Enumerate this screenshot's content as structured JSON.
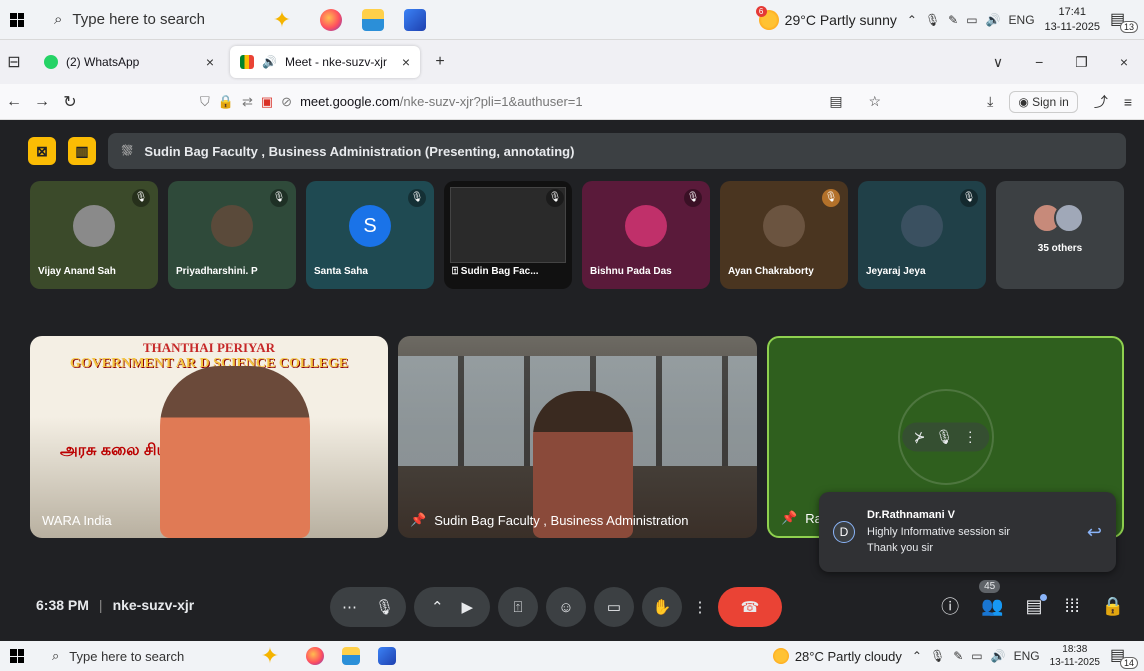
{
  "taskbar_top": {
    "search_placeholder": "Type here to search",
    "weather": "29°C  Partly sunny",
    "weather_badge": "6",
    "lang": "ENG",
    "time": "17:41",
    "date": "13-11-2025",
    "notifications": "13"
  },
  "tabs": [
    {
      "label": "(2) WhatsApp",
      "close": "×"
    },
    {
      "label": "Meet - nke-suzv-xjr",
      "close": "×"
    }
  ],
  "new_tab": "+",
  "window_controls": {
    "dropdown": "∨",
    "minimize": "−",
    "restore": "❐",
    "close": "×"
  },
  "navbar": {
    "url_host": "meet.google.com",
    "url_path": "/nke-suzv-xjr?pli=1&authuser=1",
    "sign_in": "Sign in"
  },
  "presenter_bar": {
    "text": "Sudin Bag Faculty , Business Administration (Presenting, annotating)"
  },
  "participants": [
    {
      "name": "Vijay Anand Sah",
      "bg": "#3b4a2a"
    },
    {
      "name": "Priyadharshini. P",
      "bg": "#2f4a3a"
    },
    {
      "name": "Santa Saha",
      "bg": "#1f4a52",
      "letter": "S"
    },
    {
      "name": "Sudin Bag Fac...",
      "bg": "#111"
    },
    {
      "name": "Bishnu Pada Das",
      "bg": "#5a1a3a"
    },
    {
      "name": "Ayan Chakraborty",
      "bg": "#4a3520"
    },
    {
      "name": "Jeyaraj Jeya",
      "bg": "#204048"
    }
  ],
  "others": {
    "label": "35 others"
  },
  "main_tiles": {
    "tile1": {
      "poster_line1": "THANTHAI PERIYAR",
      "poster_line2": "GOVERNMENT AR    D SCIENCE COLLEGE",
      "tamil": "அரசு கலை      சியல் கல்லூரி",
      "label": "WARA India"
    },
    "tile2": {
      "label": "Sudin Bag Faculty , Business Administration"
    },
    "tile3": {
      "label": "Ra"
    }
  },
  "chat_toast": {
    "initial": "D",
    "sender": "Dr.Rathnamani V",
    "message_line1": "Highly Informative session sir",
    "message_line2": "Thank you sir"
  },
  "controls": {
    "time": "6:38 PM",
    "meeting_code": "nke-suzv-xjr",
    "people_count": "45"
  },
  "taskbar_bottom": {
    "search_placeholder": "Type here to search",
    "weather": "28°C  Partly cloudy",
    "lang": "ENG",
    "time": "18:38",
    "date": "13-11-2025",
    "notifications": "14"
  }
}
